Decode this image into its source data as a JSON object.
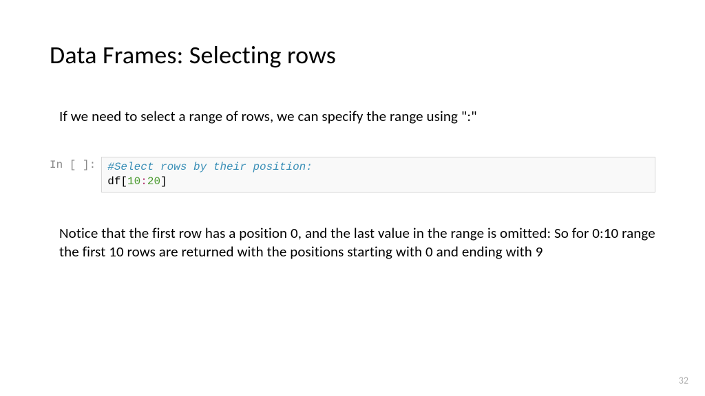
{
  "title": "Data Frames: Selecting rows",
  "intro": "If we need to select a range of rows, we can specify the range using \":\"",
  "cell": {
    "prompt": "In [ ]:",
    "comment": "#Select rows by their position:",
    "code_prefix": "df[",
    "code_num1": "10",
    "code_colon": ":",
    "code_num2": "20",
    "code_suffix": "]"
  },
  "explanation": "Notice that the first row has a position 0, and the last value in the range is omitted: So for 0:10 range the first 10 rows are returned with the positions starting with 0 and ending with 9",
  "page_number": "32"
}
